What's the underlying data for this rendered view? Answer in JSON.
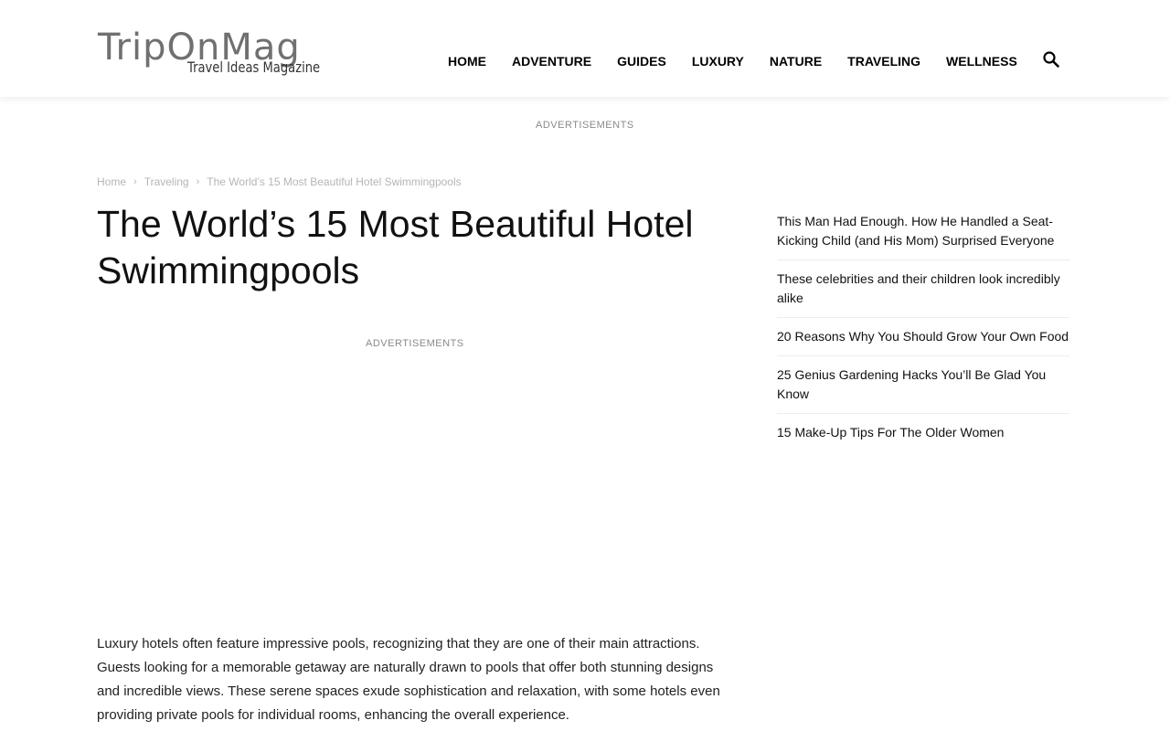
{
  "header": {
    "logo_text": "TripOnMag",
    "logo_tagline": "Travel Ideas Magazine",
    "nav": [
      "HOME",
      "ADVENTURE",
      "GUIDES",
      "LUXURY",
      "NATURE",
      "TRAVELING",
      "WELLNESS"
    ],
    "search_icon": "search-icon"
  },
  "ads": {
    "top_label": "ADVERTISEMENTS",
    "article_label": "ADVERTISEMENTS"
  },
  "breadcrumb": {
    "items": [
      "Home",
      "Traveling",
      "The World’s 15 Most Beautiful Hotel Swimmingpools"
    ],
    "separator": "›"
  },
  "article": {
    "title": "The World’s 15 Most Beautiful Hotel Swimmingpools",
    "intro": "Luxury hotels often feature impressive pools, recognizing that they are one of their main attractions. Guests looking for a memorable getaway are naturally drawn to pools that offer both stunning designs and incredible views. These serene spaces exude sophistication and relaxation, with some hotels even providing private pools for individual rooms, enhancing the overall experience."
  },
  "sidebar": {
    "items": [
      "This Man Had Enough. How He Handled a Seat-Kicking Child (and His Mom) Surprised Everyone",
      "These celebrities and their children look incredibly alike",
      "20 Reasons Why You Should Grow Your Own Food",
      "25 Genius Gardening Hacks You’ll Be Glad You Know",
      "15 Make-Up Tips For The Older Women"
    ]
  },
  "colors": {
    "logo_gray": "#707070",
    "nav_text": "#000000",
    "breadcrumb": "#b5b5b5",
    "ad_label": "#8a8a8a",
    "body_text": "#222222"
  }
}
